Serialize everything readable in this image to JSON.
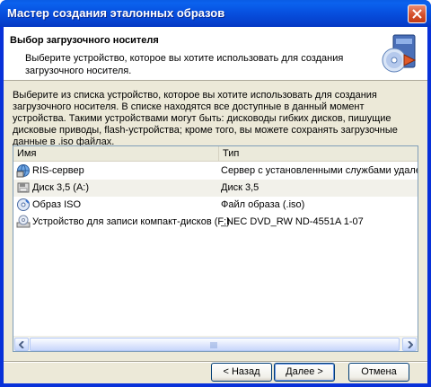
{
  "window": {
    "title": "Мастер создания эталонных образов"
  },
  "header": {
    "title": "Выбор загрузочного носителя",
    "subtitle": "Выберите устройство, которое вы хотите использовать для создания загрузочного носителя."
  },
  "instructions": "Выберите из списка устройство, которое вы хотите использовать для создания загрузочного носителя. В списке находятся все доступные в данный момент устройства. Такими устройствами могут быть: дисководы гибких дисков, пишущие дисковые приводы, flash-устройства; кроме того, вы можете сохранять загрузочные данные в .iso файлах.",
  "list": {
    "columns": [
      "Имя",
      "Тип"
    ],
    "rows": [
      {
        "name": "RIS-сервер",
        "type": "Сервер с установленными службами удаленной",
        "icon": "ris-server-icon"
      },
      {
        "name": "Диск 3,5 (A:)",
        "type": "Диск 3,5",
        "icon": "floppy-icon"
      },
      {
        "name": "Образ ISO",
        "type": "Файл образа (.iso)",
        "icon": "iso-image-icon"
      },
      {
        "name": "Устройство для записи компакт-дисков (F:)",
        "type": "_NEC DVD_RW ND-4551A 1-07",
        "icon": "cd-writer-icon"
      }
    ]
  },
  "buttons": {
    "back": "< Назад",
    "next": "Далее >",
    "cancel": "Отмена"
  },
  "colors": {
    "titlebar": "#0a5ce5",
    "client": "#ece9d8",
    "list_border": "#7f9db9"
  }
}
